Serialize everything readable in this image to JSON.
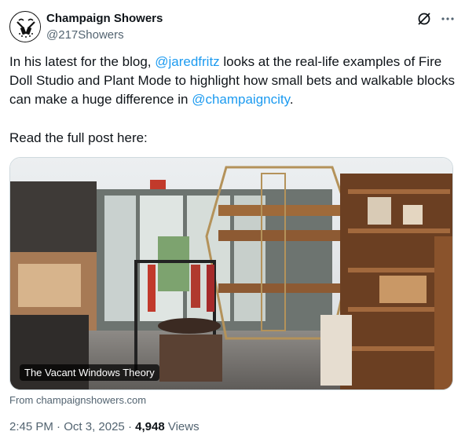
{
  "author": {
    "name": "Champaign Showers",
    "handle": "@217Showers"
  },
  "tweet": {
    "text_before": "In his latest for the blog, ",
    "mention1": "@jaredfritz",
    "text_mid": " looks at the real-life examples of Fire Doll Studio and Plant Mode to highlight how small bets and walkable blocks can make a huge difference in ",
    "mention2": "@champaigncity",
    "text_after": ".",
    "line2": "Read the full post here:"
  },
  "card": {
    "title": "The Vacant Windows Theory",
    "source": "From champaignshowers.com"
  },
  "meta": {
    "time": "2:45 PM",
    "sep1": " · ",
    "date": "Oct 3, 2025",
    "sep2": " · ",
    "views_count": "4,948",
    "views_label": " Views"
  },
  "icons": {
    "grok": "grok-icon",
    "more": "more-horizontal-icon",
    "avatar": "shower-logo-icon"
  },
  "colors": {
    "accent": "#1d9bf0",
    "text": "#0f1419",
    "secondary": "#536471",
    "border": "#cfd9de"
  }
}
